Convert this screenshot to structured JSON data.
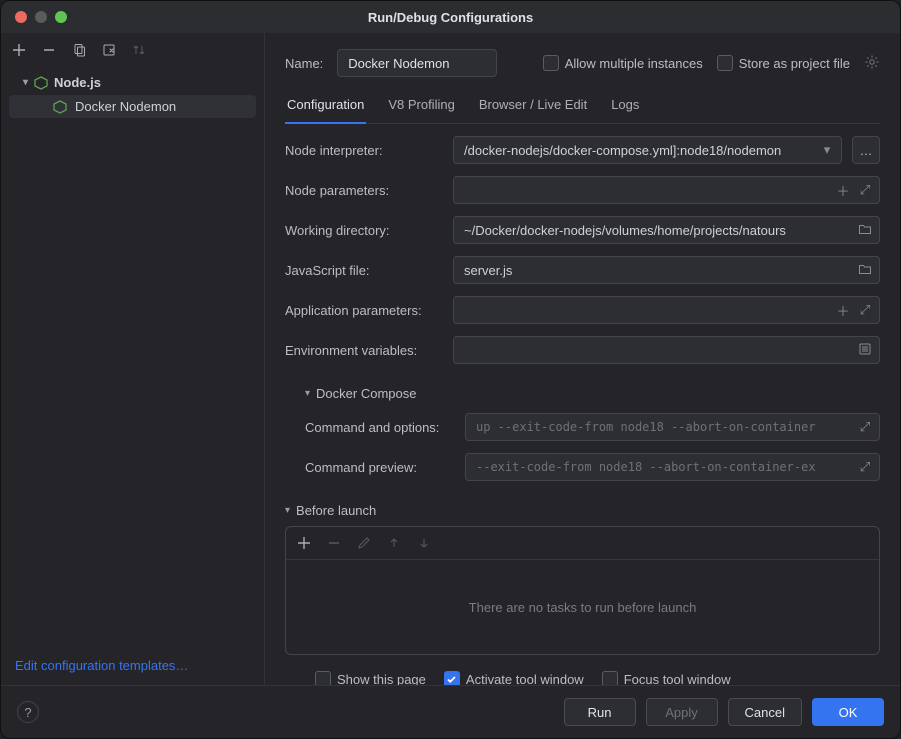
{
  "title": "Run/Debug Configurations",
  "sidebar": {
    "group": {
      "label": "Node.js"
    },
    "item": {
      "label": "Docker Nodemon"
    },
    "footer_link": "Edit configuration templates…"
  },
  "top": {
    "name_label": "Name:",
    "name_value": "Docker Nodemon",
    "allow_multiple": "Allow multiple instances",
    "store_project": "Store as project file"
  },
  "tabs": {
    "configuration": "Configuration",
    "v8": "V8 Profiling",
    "browser": "Browser / Live Edit",
    "logs": "Logs"
  },
  "fields": {
    "node_interpreter_label": "Node interpreter:",
    "node_interpreter_value": "/docker-nodejs/docker-compose.yml]:node18/nodemon",
    "node_params_label": "Node parameters:",
    "node_params_value": "",
    "workdir_label": "Working directory:",
    "workdir_value": "~/Docker/docker-nodejs/volumes/home/projects/natours",
    "jsfile_label": "JavaScript file:",
    "jsfile_value": "server.js",
    "app_params_label": "Application parameters:",
    "app_params_value": "",
    "env_label": "Environment variables:",
    "env_value": ""
  },
  "docker": {
    "header": "Docker Compose",
    "cmd_label": "Command and options:",
    "cmd_value": "up --exit-code-from node18 --abort-on-container",
    "preview_label": "Command preview:",
    "preview_value": "--exit-code-from node18 --abort-on-container-ex"
  },
  "before": {
    "header": "Before launch",
    "empty": "There are no tasks to run before launch"
  },
  "bottom": {
    "show_page": "Show this page",
    "activate_tw": "Activate tool window",
    "focus_tw": "Focus tool window"
  },
  "buttons": {
    "run": "Run",
    "apply": "Apply",
    "cancel": "Cancel",
    "ok": "OK"
  },
  "glyphs": {
    "ellipsis": "…"
  }
}
